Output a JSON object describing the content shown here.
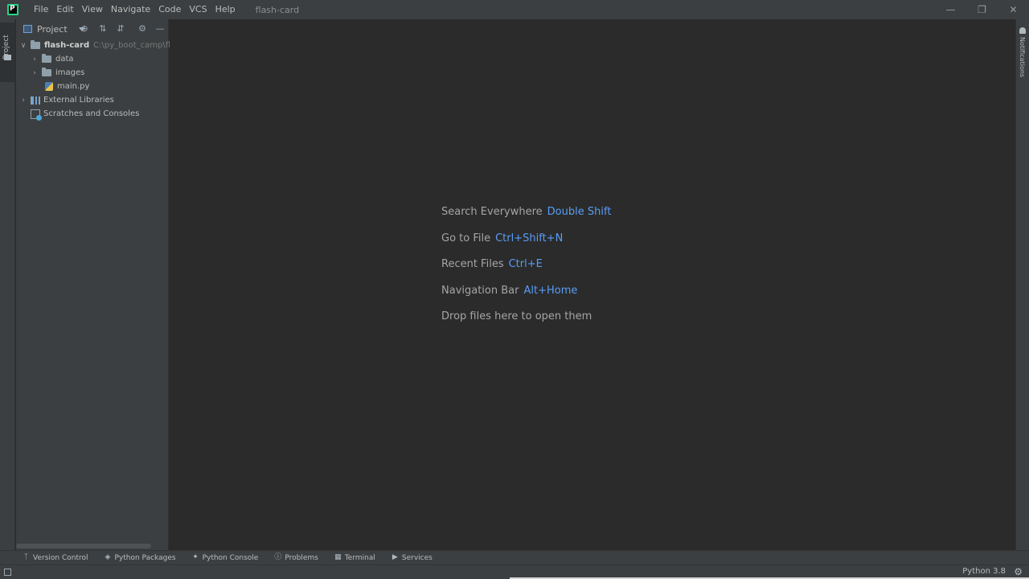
{
  "titlebar": {
    "logo_letter": "P",
    "menu": [
      "File",
      "Edit",
      "View",
      "Navigate",
      "Code",
      "VCS",
      "Help"
    ],
    "window_title": "flash-card",
    "controls": [
      "minimize-icon",
      "restore-icon",
      "close-icon"
    ]
  },
  "left_stripe": {
    "project_tab": "Project"
  },
  "right_stripe": {
    "notifications_tab": "Notifications"
  },
  "project_panel": {
    "title": "Project",
    "header_icons": [
      "locate-icon",
      "expand-all-icon",
      "collapse-all-icon",
      "gear-icon",
      "hide-icon"
    ],
    "tree": [
      {
        "label": "flash-card",
        "path": "C:\\py_boot_camp\\flash-",
        "type": "folder",
        "expanded": true,
        "depth": 0
      },
      {
        "label": "data",
        "type": "folder",
        "expanded": false,
        "depth": 1
      },
      {
        "label": "images",
        "type": "folder",
        "expanded": false,
        "depth": 1
      },
      {
        "label": "main.py",
        "type": "python-file",
        "depth": 1
      },
      {
        "label": "External Libraries",
        "type": "library",
        "expanded": false,
        "depth": 0
      },
      {
        "label": "Scratches and Consoles",
        "type": "scratches",
        "depth": 0
      }
    ]
  },
  "editor": {
    "hints": [
      {
        "text": "Search Everywhere",
        "shortcut": "Double Shift"
      },
      {
        "text": "Go to File",
        "shortcut": "Ctrl+Shift+N"
      },
      {
        "text": "Recent Files",
        "shortcut": "Ctrl+E"
      },
      {
        "text": "Navigation Bar",
        "shortcut": "Alt+Home"
      },
      {
        "text": "Drop files here to open them",
        "shortcut": ""
      }
    ]
  },
  "bottom_tools": [
    {
      "label": "Version Control",
      "icon": "branch-icon"
    },
    {
      "label": "Python Packages",
      "icon": "packages-icon"
    },
    {
      "label": "Python Console",
      "icon": "python-icon"
    },
    {
      "label": "Problems",
      "icon": "problems-icon"
    },
    {
      "label": "Terminal",
      "icon": "terminal-icon"
    },
    {
      "label": "Services",
      "icon": "services-icon"
    }
  ],
  "statusbar": {
    "interpreter": "Python 3.8"
  },
  "colors": {
    "accent": "#589df6",
    "background": "#2b2b2b",
    "panel": "#3c3f41"
  }
}
